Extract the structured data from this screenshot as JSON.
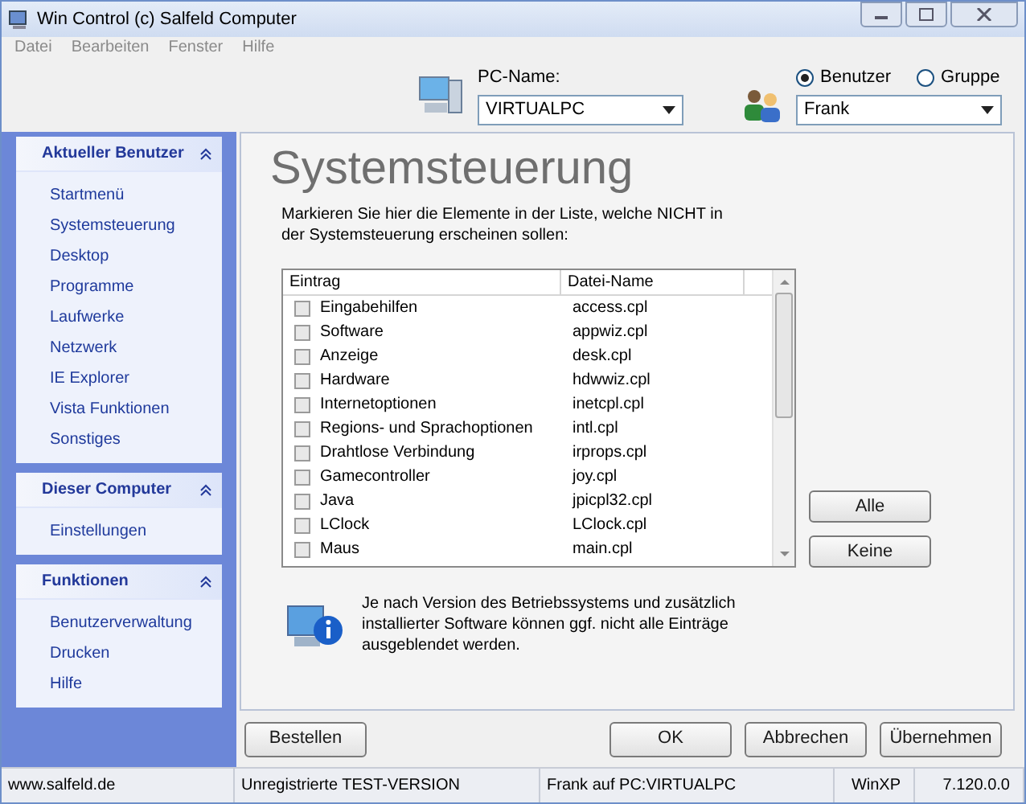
{
  "window": {
    "title": "Win Control (c) Salfeld Computer"
  },
  "menu": [
    "Datei",
    "Bearbeiten",
    "Fenster",
    "Hilfe"
  ],
  "pc": {
    "label": "PC-Name:",
    "value": "VIRTUALPC"
  },
  "scope": {
    "options": [
      {
        "label": "Benutzer",
        "selected": true
      },
      {
        "label": "Gruppe",
        "selected": false
      }
    ],
    "user": "Frank"
  },
  "sidebar": [
    {
      "title": "Aktueller Benutzer",
      "items": [
        "Startmenü",
        "Systemsteuerung",
        "Desktop",
        "Programme",
        "Laufwerke",
        "Netzwerk",
        "IE Explorer",
        "Vista Funktionen",
        "Sonstiges"
      ]
    },
    {
      "title": "Dieser Computer",
      "items": [
        "Einstellungen"
      ]
    },
    {
      "title": "Funktionen",
      "items": [
        "Benutzerverwaltung",
        "Drucken",
        "Hilfe"
      ]
    }
  ],
  "heading": "Systemsteuerung",
  "intro": "Markieren Sie hier die Elemente in der Liste, welche NICHT in der Systemsteuerung erscheinen sollen:",
  "table": {
    "columns": [
      "Eintrag",
      "Datei-Name"
    ],
    "rows": [
      {
        "name": "Eingabehilfen",
        "file": "access.cpl",
        "checked": false
      },
      {
        "name": "Software",
        "file": "appwiz.cpl",
        "checked": false
      },
      {
        "name": "Anzeige",
        "file": "desk.cpl",
        "checked": false
      },
      {
        "name": "Hardware",
        "file": "hdwwiz.cpl",
        "checked": false
      },
      {
        "name": "Internetoptionen",
        "file": "inetcpl.cpl",
        "checked": false
      },
      {
        "name": "Regions- und Sprachoptionen",
        "file": "intl.cpl",
        "checked": false
      },
      {
        "name": "Drahtlose Verbindung",
        "file": "irprops.cpl",
        "checked": false
      },
      {
        "name": "Gamecontroller",
        "file": "joy.cpl",
        "checked": false
      },
      {
        "name": "Java",
        "file": "jpicpl32.cpl",
        "checked": false
      },
      {
        "name": "LClock",
        "file": "LClock.cpl",
        "checked": false
      },
      {
        "name": "Maus",
        "file": "main.cpl",
        "checked": false
      }
    ]
  },
  "side_buttons": [
    "Alle",
    "Keine"
  ],
  "info": "Je nach Version des Betriebssystems und zusätzlich installierter Software können ggf. nicht alle Einträge ausgeblendet werden.",
  "buttons": {
    "left": "Bestellen",
    "right": [
      "OK",
      "Abbrechen",
      "Übernehmen"
    ]
  },
  "status_bar": [
    "www.salfeld.de",
    "Unregistrierte TEST-VERSION",
    "Frank auf PC:VIRTUALPC",
    "WinXP",
    "7.120.0.0"
  ]
}
